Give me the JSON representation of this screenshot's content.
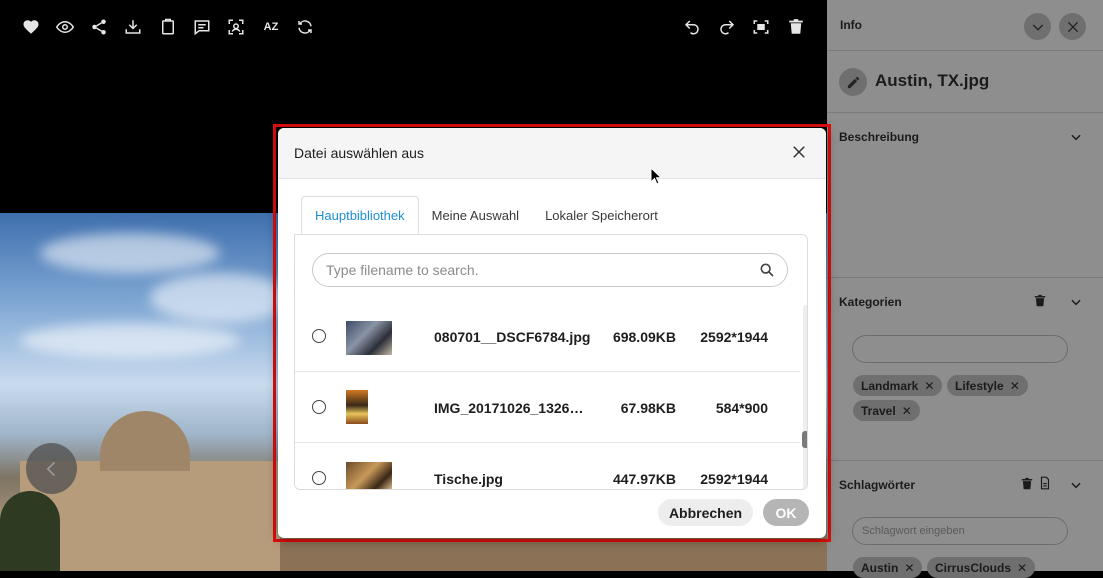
{
  "toolbar": {
    "left_icons": [
      "heart-icon",
      "eye-icon",
      "share-icon",
      "download-icon",
      "clipboard-icon",
      "comment-icon",
      "face-scan-icon",
      "az-icon",
      "refresh-icon"
    ],
    "az_label": "AZ",
    "right_icons": [
      "undo-icon",
      "redo-icon",
      "fullscreen-icon",
      "trash-icon"
    ]
  },
  "panel": {
    "title": "Info",
    "file_name": "Austin, TX.jpg",
    "sections": {
      "description": {
        "title": "Beschreibung"
      },
      "categories": {
        "title": "Kategorien",
        "input_value": "",
        "tags": [
          "Landmark",
          "Lifestyle",
          "Travel"
        ]
      },
      "keywords": {
        "title": "Schlagwörter",
        "placeholder": "Schlagwort eingeben",
        "tags": [
          "Austin",
          "CirrusClouds"
        ]
      }
    }
  },
  "dialog": {
    "title": "Datei auswählen aus",
    "tabs": [
      {
        "label": "Hauptbibliothek",
        "active": true
      },
      {
        "label": "Meine Auswahl",
        "active": false
      },
      {
        "label": "Lokaler Speicherort",
        "active": false
      }
    ],
    "search_placeholder": "Type filename to search.",
    "files": [
      {
        "name": "080701__DSCF6784.jpg",
        "size": "698.09KB",
        "dimensions": "2592*1944",
        "selected": false
      },
      {
        "name": "IMG_20171026_1326…",
        "size": "67.98KB",
        "dimensions": "584*900",
        "selected": false
      },
      {
        "name": "Tische.jpg",
        "size": "447.97KB",
        "dimensions": "2592*1944",
        "selected": false
      }
    ],
    "cancel_label": "Abbrechen",
    "ok_label": "OK"
  },
  "colors": {
    "accent": "#1d8fd6",
    "highlight_frame": "#e10d0d",
    "panel_bg": "#8e8e8e"
  }
}
